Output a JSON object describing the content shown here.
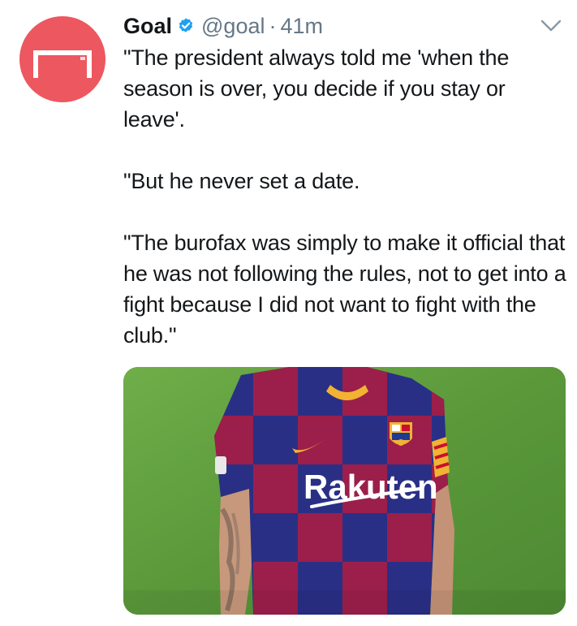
{
  "tweet": {
    "author_name": "Goal",
    "handle": "@goal",
    "separator": "·",
    "time": "41m",
    "text": "\"The president always told me 'when the season is over, you decide if you stay or leave'.\n\n\"But he never set a date.\n\n\"The burofax was simply to make it official that he was not following the rules, not to get into a fight because I did not want to fight with the club.\"",
    "media": {
      "sponsor_text": "Rakuten",
      "description_icon": "football-player-photo"
    }
  },
  "icons": {
    "verified": "verified-badge-icon",
    "menu": "chevron-down-icon",
    "avatar": "goal-logo"
  },
  "colors": {
    "avatar_bg": "#ed5760",
    "verified": "#1da1f2",
    "meta_text": "#657786",
    "primary_text": "#14171a"
  }
}
